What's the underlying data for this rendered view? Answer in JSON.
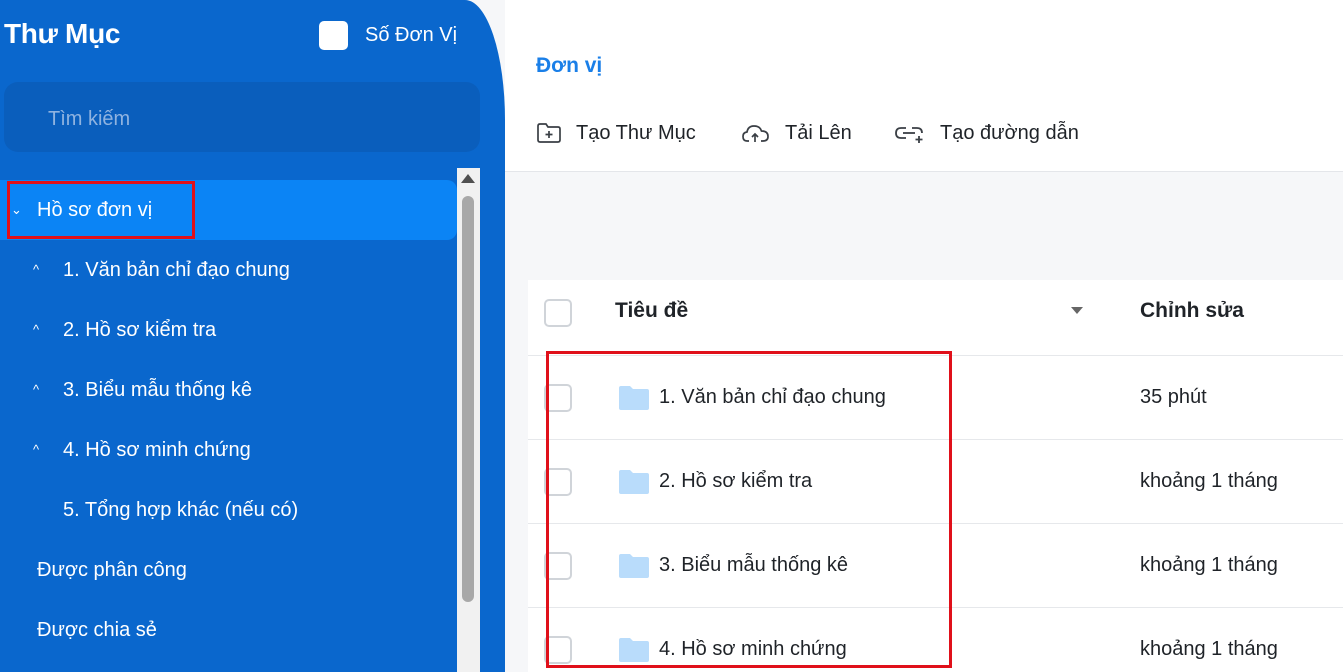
{
  "sidebar": {
    "title": "Thư Mục",
    "checkbox_label": "Số Đơn Vị",
    "search_placeholder": "Tìm kiếm",
    "items": [
      {
        "label": "Hồ sơ đơn vị",
        "chevron": "⌄",
        "level": 0,
        "selected": true
      },
      {
        "label": "1. Văn bản chỉ đạo chung",
        "chevron": "^",
        "level": 1
      },
      {
        "label": "2. Hồ sơ kiểm tra",
        "chevron": "^",
        "level": 1
      },
      {
        "label": "3. Biểu mẫu thống kê",
        "chevron": "^",
        "level": 1
      },
      {
        "label": "4. Hồ sơ minh chứng",
        "chevron": "^",
        "level": 1
      },
      {
        "label": "5. Tổng hợp khác (nếu có)",
        "chevron": "",
        "level": 1
      },
      {
        "label": "Được phân công",
        "chevron": "",
        "level": 0
      },
      {
        "label": "Được chia sẻ",
        "chevron": "",
        "level": 0
      }
    ]
  },
  "header": {
    "breadcrumb": "Đơn vị",
    "actions": [
      {
        "label": "Tạo Thư Mục",
        "icon": "folder-plus-icon"
      },
      {
        "label": "Tải Lên",
        "icon": "cloud-upload-icon"
      },
      {
        "label": "Tạo đường dẫn",
        "icon": "link-plus-icon"
      }
    ]
  },
  "table": {
    "columns": [
      "Tiêu đề",
      "Chỉnh sửa"
    ],
    "rows": [
      {
        "title": "1. Văn bản chỉ đạo chung",
        "edited": "35 phút"
      },
      {
        "title": "2. Hồ sơ kiểm tra",
        "edited": "khoảng 1 tháng"
      },
      {
        "title": "3. Biểu mẫu thống kê",
        "edited": "khoảng 1 tháng"
      },
      {
        "title": "4. Hồ sơ minh chứng",
        "edited": "khoảng 1 tháng"
      }
    ]
  },
  "colors": {
    "sidebar_bg": "#0a67cd",
    "selected_bg": "#0b84f5",
    "accent": "#1a7fe8",
    "highlight": "#e0101a",
    "folder": "#b9dcfb"
  }
}
